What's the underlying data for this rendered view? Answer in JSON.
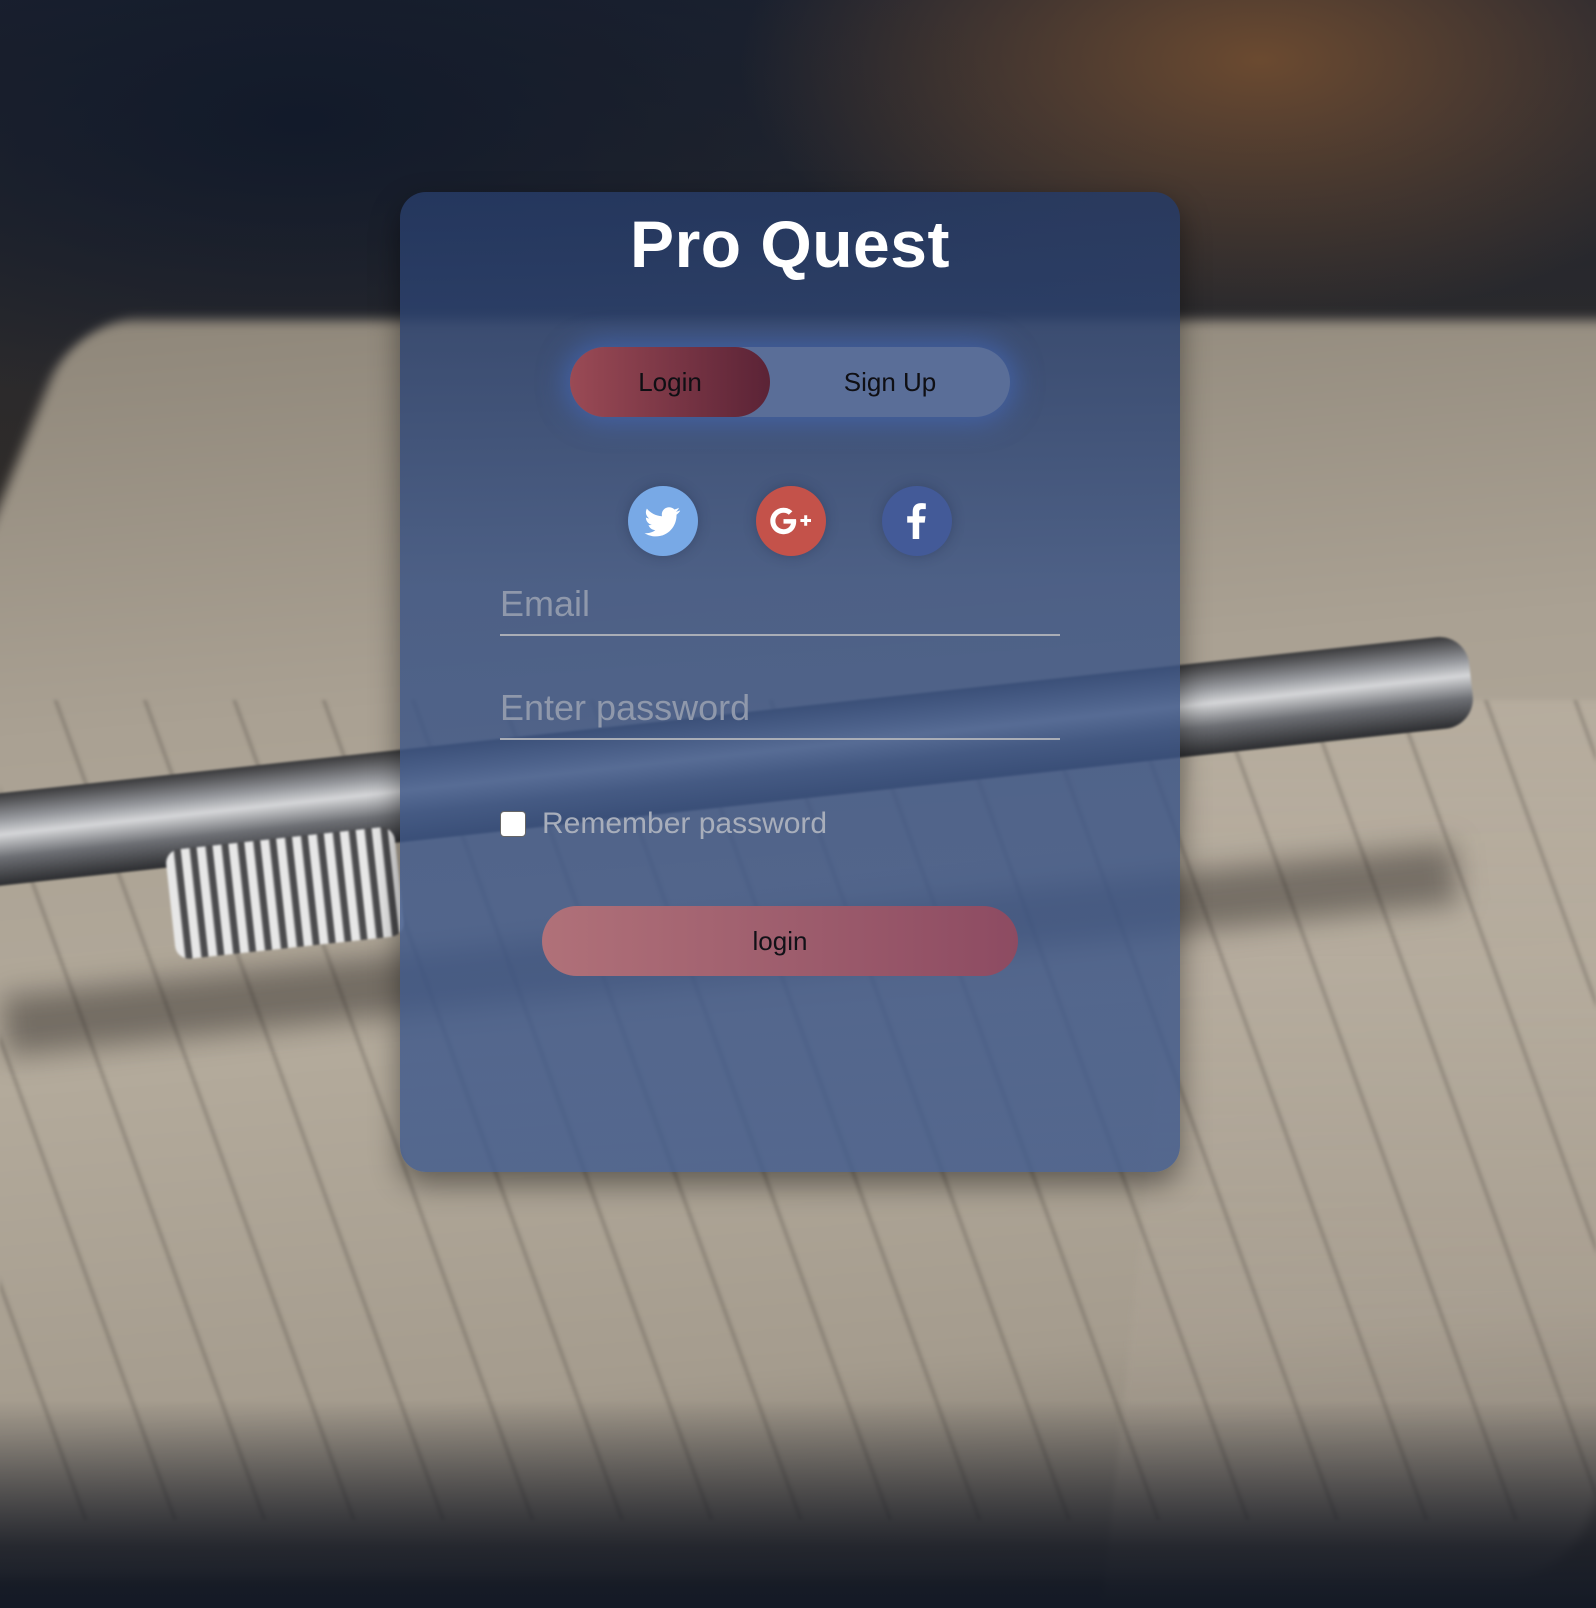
{
  "app": {
    "title": "Pro Quest"
  },
  "auth_toggle": {
    "options": [
      {
        "label": "Login",
        "active": true
      },
      {
        "label": "Sign Up",
        "active": false
      }
    ]
  },
  "social": [
    {
      "name": "twitter",
      "icon": "twitter-icon",
      "color": "#78a9e6"
    },
    {
      "name": "google-plus",
      "icon": "google-plus-icon",
      "color": "#c4524a"
    },
    {
      "name": "facebook",
      "icon": "facebook-icon",
      "color": "#435a98"
    }
  ],
  "form": {
    "email": {
      "value": "",
      "placeholder": "Email"
    },
    "password": {
      "value": "",
      "placeholder": "Enter password"
    },
    "remember": {
      "label": "Remember password",
      "checked": false
    },
    "submit_label": "login"
  },
  "colors": {
    "card": "#3a5384",
    "toggle_active": "#9a4a55",
    "submit_button": "#b07179"
  }
}
